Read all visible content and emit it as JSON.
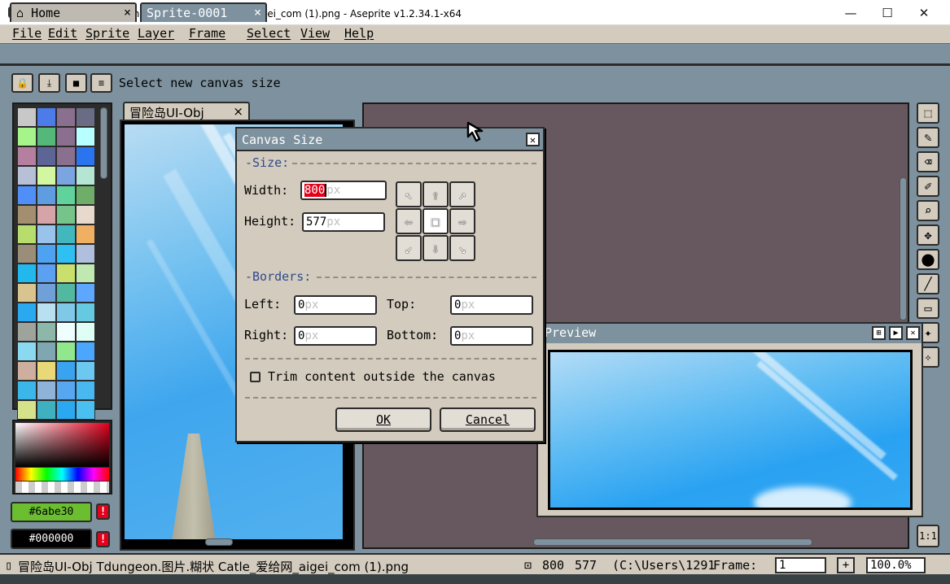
{
  "window": {
    "title": "冒险岛UI-Obj Tdungeon.图片.糊状 Catle_爱给网_aigei_com (1).png - Aseprite v1.2.34.1-x64",
    "minimize": "—",
    "maximize": "☐",
    "close": "✕"
  },
  "menu": [
    "File",
    "Edit",
    "Sprite",
    "Layer",
    "Frame",
    "Select",
    "View",
    "Help"
  ],
  "tabs": [
    {
      "label": "Home",
      "icon": "home-icon",
      "close": "×"
    },
    {
      "label": "Sprite-0001",
      "close": "×"
    }
  ],
  "toolbar": {
    "buttons": [
      "lock-icon",
      "download-icon",
      "stop-icon",
      "menu-icon"
    ],
    "glyphs": [
      "🔒",
      "⤓",
      "■",
      "≡"
    ],
    "message": "Select new canvas size"
  },
  "palette": {
    "colors": [
      "#c8c8c8",
      "#4c7bea",
      "#8a6f8f",
      "#6a6b85",
      "#a5f58a",
      "#54b87a",
      "#8a6f8f",
      "#b8ffff",
      "#b57fa0",
      "#5d6496",
      "#8a6f8f",
      "#2a74f0",
      "#b8c0d8",
      "#d3f6a0",
      "#7ba5e0",
      "#b5e6d3",
      "#4f8ff7",
      "#5d9de0",
      "#5fd39b",
      "#6fae69",
      "#a38f6f",
      "#d6a3a8",
      "#77c48a",
      "#e7d9cb",
      "#b7dd6c",
      "#99c3ea",
      "#42b8be",
      "#efb064",
      "#9b8e78",
      "#4ea2f2",
      "#2ec0f2",
      "#b1bfdf",
      "#22b8ee",
      "#5ca0f2",
      "#c9e06d",
      "#bfe9b1",
      "#d9c48f",
      "#6fa0d8",
      "#52b89f",
      "#5ea7ff",
      "#2aa8f0",
      "#b8e0f0",
      "#7fc8e8",
      "#65c9df",
      "#9ea39b",
      "#8db8a9",
      "#efffff",
      "#dffff6",
      "#8ad9f0",
      "#7ea7b1",
      "#91e88c",
      "#4aa6ff",
      "#cdae9f",
      "#e8d878",
      "#3aa3f0",
      "#6cc8f0",
      "#3bb6e8",
      "#8fb3d8",
      "#57a6f0",
      "#4ab8f0",
      "#d6e28a",
      "#3fb0c0",
      "#2aa8f0",
      "#4ac0f0"
    ]
  },
  "colors": {
    "foreground_hex": "#6abe30",
    "background_hex": "#000000",
    "foreground_label": "#6abe30",
    "background_label": "#000000",
    "warning": "!"
  },
  "document": {
    "tab_label": "冒险岛UI-Obj",
    "tab_close": "×"
  },
  "tools": {
    "icons": [
      "rectangular-marquee-icon",
      "pencil-icon",
      "eraser-icon",
      "eyedropper-icon",
      "zoom-icon",
      "move-icon",
      "paint-bucket-icon",
      "line-icon",
      "rectangle-icon",
      "contour-icon",
      "blur-icon"
    ],
    "glyphs": [
      "⬚",
      "✎",
      "⌫",
      "✐",
      "⌕",
      "✥",
      "⬤",
      "╱",
      "▭",
      "✦",
      "✧"
    ],
    "zoom_label": "1:1"
  },
  "dialog": {
    "title": "Canvas Size",
    "close": "✕",
    "size_section": "Size:",
    "width_label": "Width:",
    "width_value": "800",
    "height_label": "Height:",
    "height_value": "577",
    "unit": "px",
    "anchors": [
      "↖",
      "⇧",
      "↗",
      "⇦",
      "□",
      "⇨",
      "↙",
      "⇩",
      "↘"
    ],
    "borders_section": "Borders:",
    "left_label": "Left:",
    "left_value": "0",
    "top_label": "Top:",
    "top_value": "0",
    "right_label": "Right:",
    "right_value": "0",
    "bottom_label": "Bottom:",
    "bottom_value": "0",
    "trim_label": "Trim content outside the canvas",
    "trim_checked": false,
    "ok": "OK",
    "cancel": "Cancel"
  },
  "preview": {
    "title": "Preview",
    "buttons": [
      "⊞",
      "▶",
      "✕"
    ]
  },
  "status": {
    "filename": "冒险岛UI-Obj Tdungeon.图片.糊状 Catle_爱给网_aigei_com (1).png",
    "size_w": "800",
    "size_h": "577",
    "path": "(C:\\Users\\1291",
    "frame_label": "Frame:",
    "frame_value": "1",
    "plus": "+",
    "zoom": "100.0%"
  }
}
